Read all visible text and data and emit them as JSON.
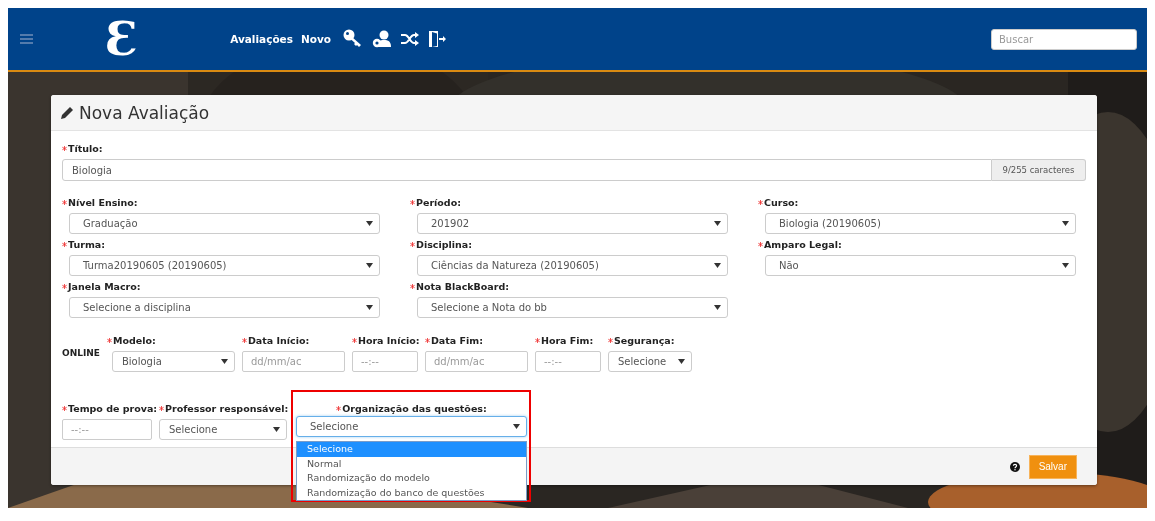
{
  "navbar": {
    "logo": "Ɛ",
    "links": [
      {
        "label": "Avaliações"
      },
      {
        "label": "Novo"
      }
    ],
    "search": {
      "placeholder": "Buscar"
    }
  },
  "card": {
    "title": "Nova Avaliação",
    "titulo": {
      "label": "Título:",
      "required": true,
      "value": "Biologia",
      "counter": "9/255 caracteres"
    },
    "fields": [
      {
        "label": "Nível Ensino:",
        "required": true,
        "value": "Graduação"
      },
      {
        "label": "Período:",
        "required": true,
        "value": "201902"
      },
      {
        "label": "Curso:",
        "required": true,
        "value": "Biologia (20190605)"
      },
      {
        "label": "Turma:",
        "required": true,
        "value": "Turma20190605 (20190605)"
      },
      {
        "label": "Disciplina:",
        "required": true,
        "value": "Ciências da Natureza (20190605)"
      },
      {
        "label": "Amparo Legal:",
        "required": true,
        "value": "Não"
      },
      {
        "label": "Janela Macro:",
        "required": true,
        "value": "Selecione a disciplina"
      },
      {
        "label": "Nota BlackBoard:",
        "required": true,
        "value": "Selecione a Nota do bb"
      }
    ],
    "online": {
      "label": "ONLINE",
      "fields": [
        {
          "kind": "select",
          "label": "Modelo:",
          "required": true,
          "value": "Biologia"
        },
        {
          "kind": "input",
          "label": "Data Início:",
          "required": true,
          "placeholder": "dd/mm/ac"
        },
        {
          "kind": "input",
          "label": "Hora Início:",
          "required": true,
          "placeholder": "--:--"
        },
        {
          "kind": "input",
          "label": "Data Fim:",
          "required": true,
          "placeholder": "dd/mm/ac"
        },
        {
          "kind": "input",
          "label": "Hora Fim:",
          "required": true,
          "placeholder": "--:--"
        },
        {
          "kind": "select",
          "label": "Segurança:",
          "required": true,
          "value": "Selecione"
        }
      ]
    },
    "bottom_fields": [
      {
        "kind": "input",
        "label": "Tempo de prova:",
        "required": true,
        "placeholder": "--:--"
      },
      {
        "kind": "select",
        "label": "Professor responsável:",
        "required": true,
        "value": "Selecione"
      }
    ],
    "organization": {
      "label": "Organização das questões:",
      "required": true,
      "value": "Selecione",
      "expanded": true,
      "highlighted": true,
      "options": [
        {
          "label": "Selecione",
          "selected": true
        },
        {
          "label": "Normal",
          "selected": false
        },
        {
          "label": "Randomização do modelo",
          "selected": false
        },
        {
          "label": "Randomização do banco de questões",
          "selected": false
        }
      ]
    },
    "save_button": "Salvar"
  }
}
